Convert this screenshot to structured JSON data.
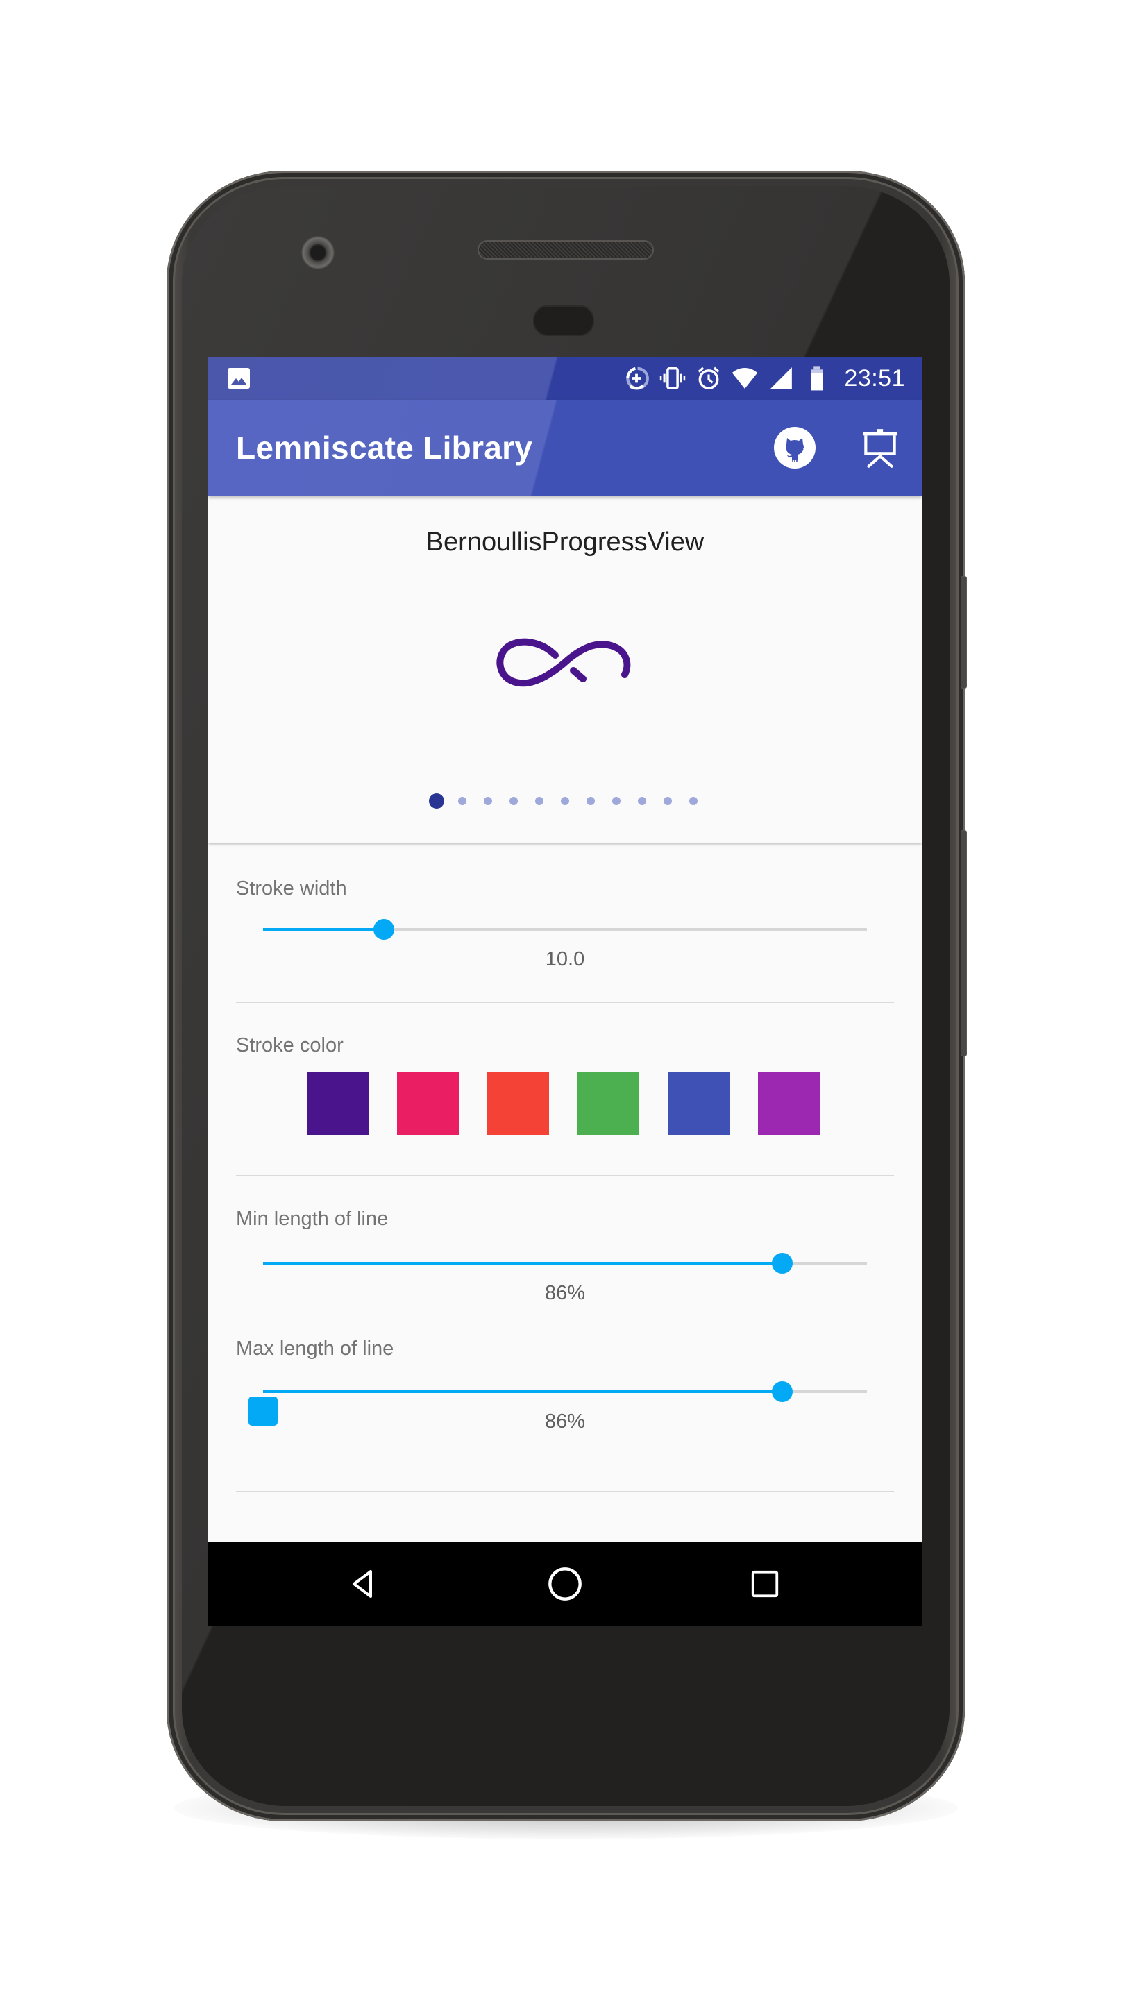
{
  "status_bar": {
    "left_icons": [
      "image-notification-icon"
    ],
    "right_icons": [
      "data-saver-icon",
      "vibrate-icon",
      "alarm-icon",
      "wifi-icon",
      "cell-signal-icon",
      "battery-icon"
    ],
    "time": "23:51"
  },
  "toolbar": {
    "title": "Lemniscate Library",
    "actions": [
      {
        "name": "github",
        "icon": "github-icon"
      },
      {
        "name": "presentation",
        "icon": "presentation-icon"
      }
    ],
    "colors": {
      "primary": "#3F51B5",
      "primary_dark": "#303F9F"
    }
  },
  "demo": {
    "title": "BernoullisProgressView",
    "stroke_color": "#4A148C",
    "pager": {
      "count": 11,
      "active_index": 0,
      "active_color": "#283593",
      "inactive_color": "#9FA8DA"
    }
  },
  "settings": {
    "stroke_width": {
      "label": "Stroke width",
      "value_text": "10.0",
      "fraction": 0.2
    },
    "stroke_color": {
      "label": "Stroke color",
      "swatches": [
        "#4A148C",
        "#E91E63",
        "#F44336",
        "#4CAF50",
        "#3F51B5",
        "#9C27B0"
      ]
    },
    "min_length": {
      "label": "Min length of line",
      "value_text": "86%",
      "fraction": 0.86
    },
    "max_length": {
      "label": "Max length of line",
      "value_text": "86%",
      "fraction": 0.86
    },
    "checkbox": {
      "checked": true,
      "label": ""
    },
    "accent_color": "#03A9F4"
  },
  "nav_bar": {
    "buttons": [
      {
        "name": "back",
        "icon": "back-triangle-icon"
      },
      {
        "name": "home",
        "icon": "home-circle-icon"
      },
      {
        "name": "recents",
        "icon": "recents-square-icon"
      }
    ]
  }
}
